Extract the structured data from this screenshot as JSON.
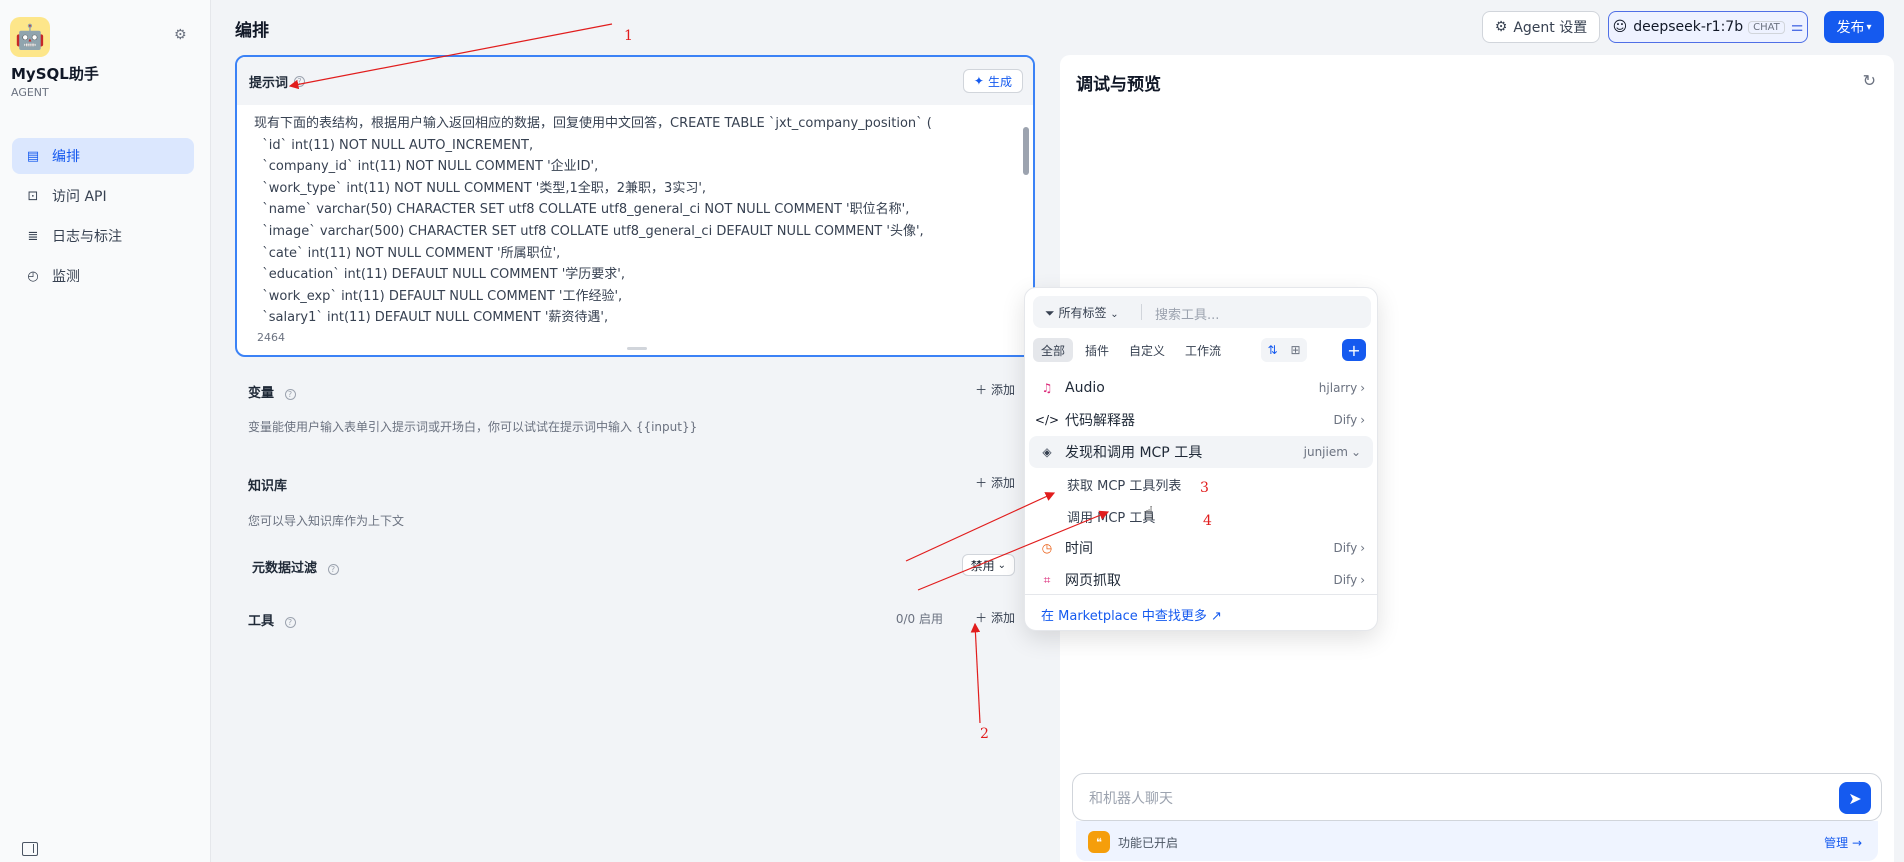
{
  "sidebar": {
    "app_name": "MySQL助手",
    "app_type": "AGENT",
    "items": [
      {
        "icon": "layout-icon",
        "glyph": "▤",
        "label": "编排",
        "active": true
      },
      {
        "icon": "terminal-icon",
        "glyph": "⊡",
        "label": "访问 API",
        "active": false
      },
      {
        "icon": "log-icon",
        "glyph": "≣",
        "label": "日志与标注",
        "active": false
      },
      {
        "icon": "monitor-icon",
        "glyph": "◴",
        "label": "监测",
        "active": false
      }
    ]
  },
  "header": {
    "title": "编排",
    "agent_settings": "Agent 设置",
    "model_name": "deepseek-r1:7b",
    "model_badge": "CHAT",
    "publish": "发布"
  },
  "prompt": {
    "title": "提示词",
    "generate": "生成",
    "text": "现有下面的表结构，根据用户输入返回相应的数据，回复使用中文回答，CREATE TABLE `jxt_company_position` (\n  `id` int(11) NOT NULL AUTO_INCREMENT,\n  `company_id` int(11) NOT NULL COMMENT '企业ID',\n  `work_type` int(11) NOT NULL COMMENT '类型,1全职，2兼职，3实习',\n  `name` varchar(50) CHARACTER SET utf8 COLLATE utf8_general_ci NOT NULL COMMENT '职位名称',\n  `image` varchar(500) CHARACTER SET utf8 COLLATE utf8_general_ci DEFAULT NULL COMMENT '头像',\n  `cate` int(11) NOT NULL COMMENT '所属职位',\n  `education` int(11) DEFAULT NULL COMMENT '学历要求',\n  `work_exp` int(11) DEFAULT NULL COMMENT '工作经验',\n  `salary1` int(11) DEFAULT NULL COMMENT '薪资待遇',",
    "count": "2464"
  },
  "variables": {
    "title": "变量",
    "add": "添加",
    "desc": "变量能使用户输入表单引入提示词或开场白，你可以试试在提示词中输入 {{input}}"
  },
  "knowledge": {
    "title": "知识库",
    "add": "添加",
    "desc": "您可以导入知识库作为上下文",
    "meta_filter": "元数据过滤",
    "meta_value": "禁用"
  },
  "tools": {
    "title": "工具",
    "count": "0/0 启用",
    "add": "添加"
  },
  "preview": {
    "title": "调试与预览",
    "chat_placeholder": "和机器人聊天",
    "feature_text": "功能已开启",
    "manage": "管理"
  },
  "dropdown": {
    "tag_filter": "所有标签",
    "search_placeholder": "搜索工具...",
    "tabs": [
      {
        "label": "全部",
        "active": true
      },
      {
        "label": "插件",
        "active": false
      },
      {
        "label": "自定义",
        "active": false
      },
      {
        "label": "工作流",
        "active": false
      }
    ],
    "items": [
      {
        "label": "Audio",
        "source": "hjlarry",
        "icon": "audio-icon",
        "glyph": "♫",
        "color": "#db2777",
        "type": "item",
        "arrow": "›"
      },
      {
        "label": "代码解释器",
        "source": "Dify",
        "icon": "code-icon",
        "glyph": "</>",
        "color": "#111827",
        "type": "item",
        "arrow": "›"
      },
      {
        "label": "发现和调用 MCP 工具",
        "source": "junjiem",
        "icon": "mcp-icon",
        "glyph": "◈",
        "color": "#374151",
        "type": "hover",
        "arrow": "⌄"
      },
      {
        "label": "获取 MCP 工具列表",
        "source": "",
        "icon": "",
        "glyph": "",
        "color": "",
        "type": "sub",
        "arrow": ""
      },
      {
        "label": "调用 MCP 工具",
        "source": "",
        "icon": "",
        "glyph": "",
        "color": "",
        "type": "sub",
        "arrow": ""
      },
      {
        "label": "时间",
        "source": "Dify",
        "icon": "clock-icon",
        "glyph": "◷",
        "color": "#ea580c",
        "type": "item",
        "arrow": "›"
      },
      {
        "label": "网页抓取",
        "source": "Dify",
        "icon": "crawl-icon",
        "glyph": "⌗",
        "color": "#db2777",
        "type": "item",
        "arrow": "›"
      }
    ],
    "footer_link": "在 Marketplace 中查找更多 ↗"
  },
  "annotations": [
    "1",
    "2",
    "3",
    "4"
  ],
  "colors": {
    "accent": "#155aef",
    "annotation": "#e11d1d"
  }
}
